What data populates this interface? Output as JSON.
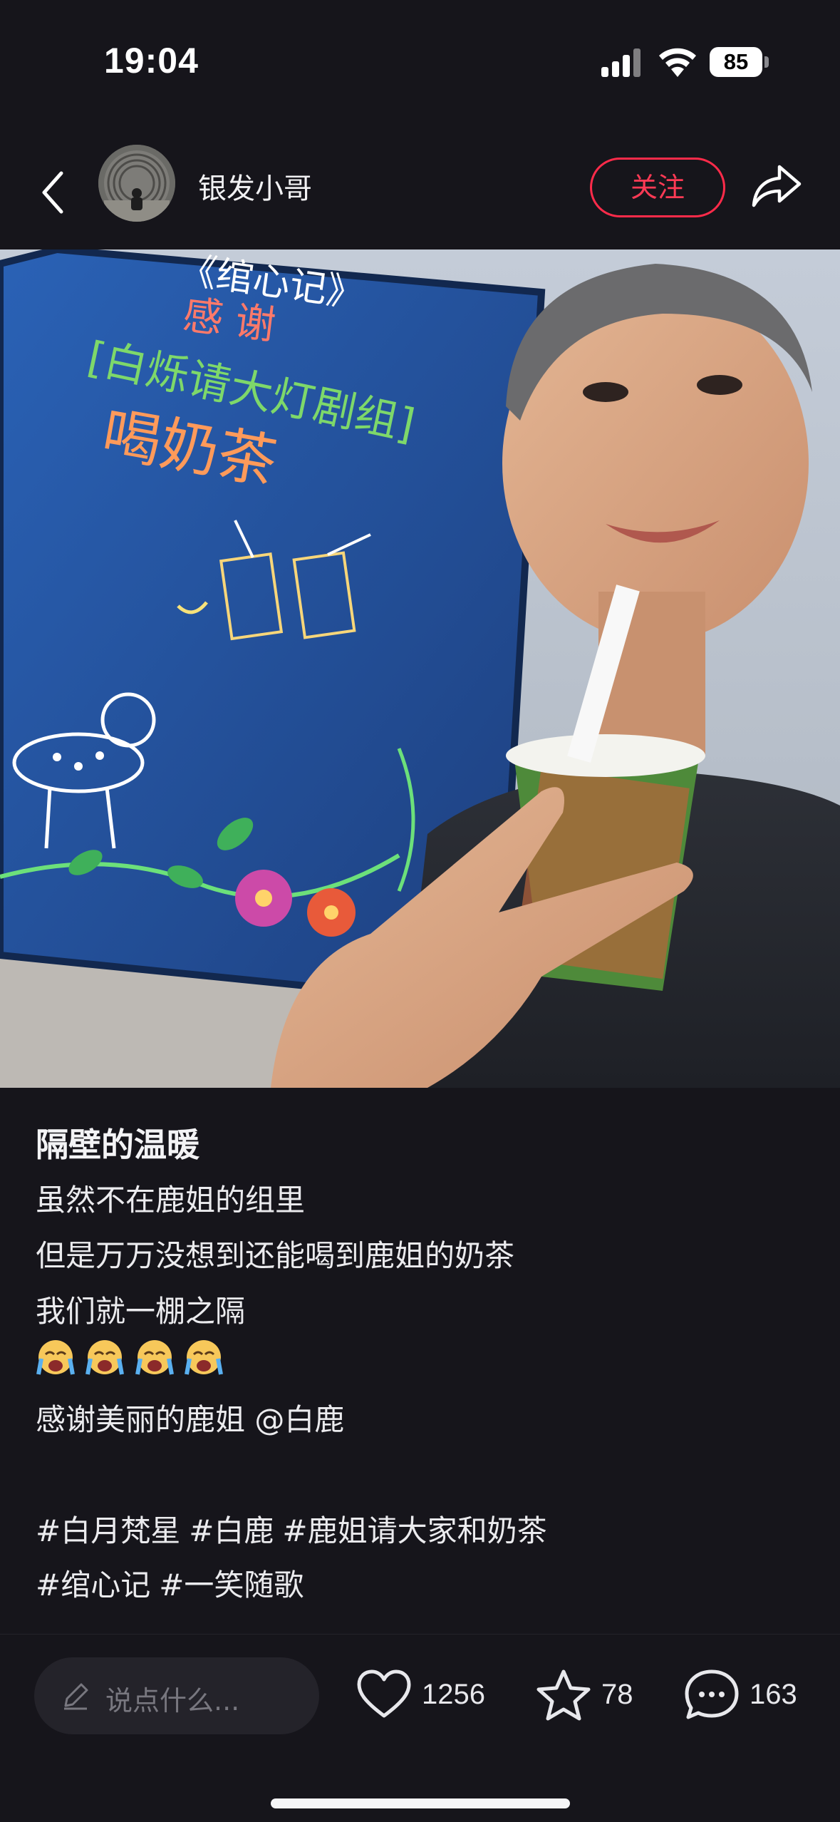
{
  "status_bar": {
    "time": "19:04",
    "battery": "85",
    "icons": [
      "signal-icon",
      "wifi-icon",
      "battery-icon"
    ]
  },
  "header": {
    "back_icon": "chevron-left-icon",
    "author_name": "银发小哥",
    "follow_label": "关注",
    "share_icon": "share-arrow-icon",
    "accent_color": "#ff2b4a"
  },
  "photo": {
    "board_text": [
      "《绾心记》",
      "感谢",
      "[白烁请大灯剧组]",
      "喝奶茶"
    ]
  },
  "post": {
    "title": "隔壁的温暖",
    "lines": [
      "虽然不在鹿姐的组里",
      "但是万万没想到还能喝到鹿姐的奶茶",
      "我们就一棚之隔"
    ],
    "emoji_count": 4,
    "thanks_prefix": "感谢美丽的鹿姐",
    "mention": "@白鹿",
    "hashtags_row1": [
      "#白月梵星",
      "#白鹿",
      "#鹿姐请大家和奶茶"
    ],
    "hashtags_row2": [
      "#绾心记",
      "#一笑随歌"
    ]
  },
  "bottom_bar": {
    "comment_placeholder": "说点什么...",
    "likes": "1256",
    "favorites": "78",
    "comments": "163"
  }
}
